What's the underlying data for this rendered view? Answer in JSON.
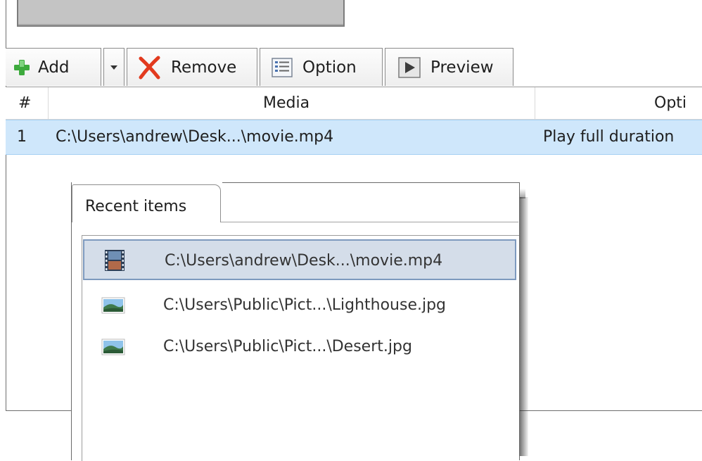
{
  "toolbar": {
    "add_label": "Add",
    "remove_label": "Remove",
    "option_label": "Option",
    "preview_label": "Preview"
  },
  "grid": {
    "columns": [
      "#",
      "Media",
      "Opti"
    ],
    "rows": [
      {
        "num": "1",
        "media": "C:\\Users\\andrew\\Desk...\\movie.mp4",
        "option": "Play full duration"
      }
    ]
  },
  "recent": {
    "tab_label": "Recent items",
    "items": [
      {
        "path": "C:\\Users\\andrew\\Desk...\\movie.mp4",
        "icon": "video-file-icon",
        "selected": true
      },
      {
        "path": "C:\\Users\\Public\\Pict...\\Lighthouse.jpg",
        "icon": "image-file-icon",
        "selected": false
      },
      {
        "path": "C:\\Users\\Public\\Pict...\\Desert.jpg",
        "icon": "image-file-icon",
        "selected": false
      }
    ]
  },
  "colors": {
    "selection_row": "#cfe7fb",
    "popup_selection": "#d4dde9",
    "add_icon": "#3daa3d",
    "remove_icon": "#e23a1e"
  }
}
